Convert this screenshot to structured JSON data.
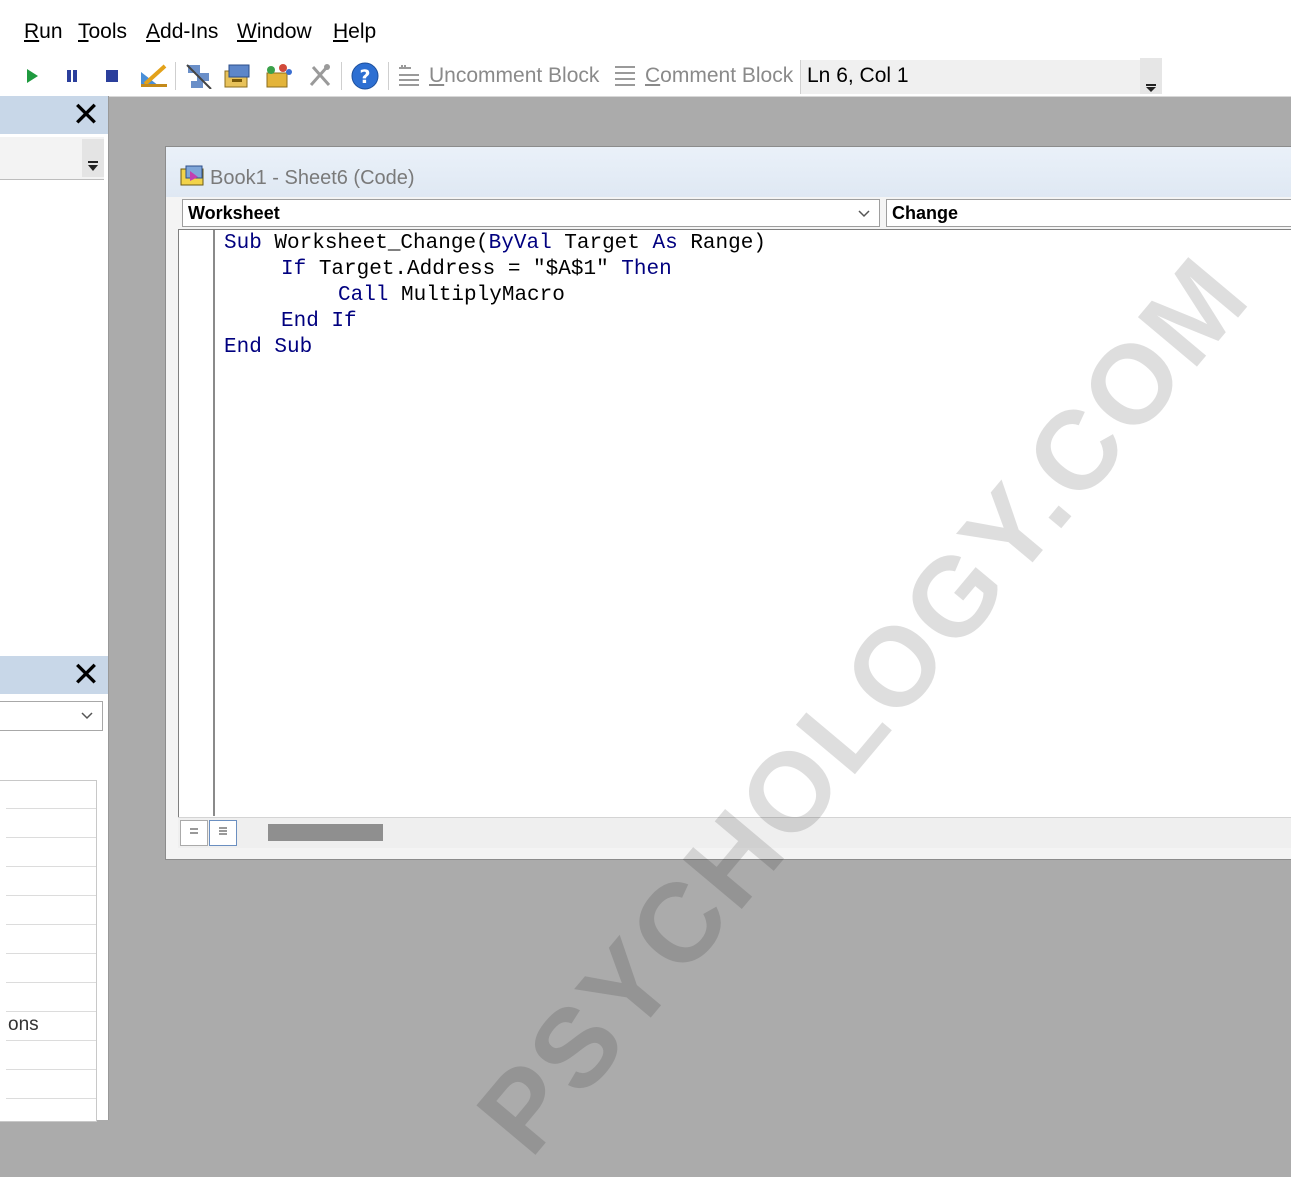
{
  "menu": [
    {
      "key": "R",
      "rest": "un"
    },
    {
      "key": "T",
      "rest": "ools"
    },
    {
      "key": "A",
      "rest": "dd-Ins"
    },
    {
      "key": "W",
      "rest": "indow"
    },
    {
      "key": "H",
      "rest": "elp"
    }
  ],
  "toolbar": {
    "uncomment_key": "U",
    "uncomment_rest": "ncomment Block",
    "comment_key": "C",
    "comment_rest": "omment Block",
    "position": "Ln 6, Col 1"
  },
  "left_panes": {
    "properties_row_text": "ons"
  },
  "code_window": {
    "title": "Book1 - Sheet6 (Code)",
    "object_dropdown": "Worksheet",
    "procedure_dropdown": "Change",
    "code": {
      "l1_a": "Sub",
      "l1_b": " Worksheet_Change(",
      "l1_c": "ByVal",
      "l1_d": " Target ",
      "l1_e": "As",
      "l1_f": " Range)",
      "l2_a": "If",
      "l2_b": " Target.Address = \"$A$1\" ",
      "l2_c": "Then",
      "l3_a": "Call",
      "l3_b": " MultiplyMacro",
      "l4_a": "End If",
      "l5_a": "End Sub"
    }
  },
  "watermark": "PSYCHOLOGY.COM",
  "colors": {
    "keyword": "#00007f",
    "pane_header": "#c8d7e8",
    "mdi_background": "#ababab"
  }
}
